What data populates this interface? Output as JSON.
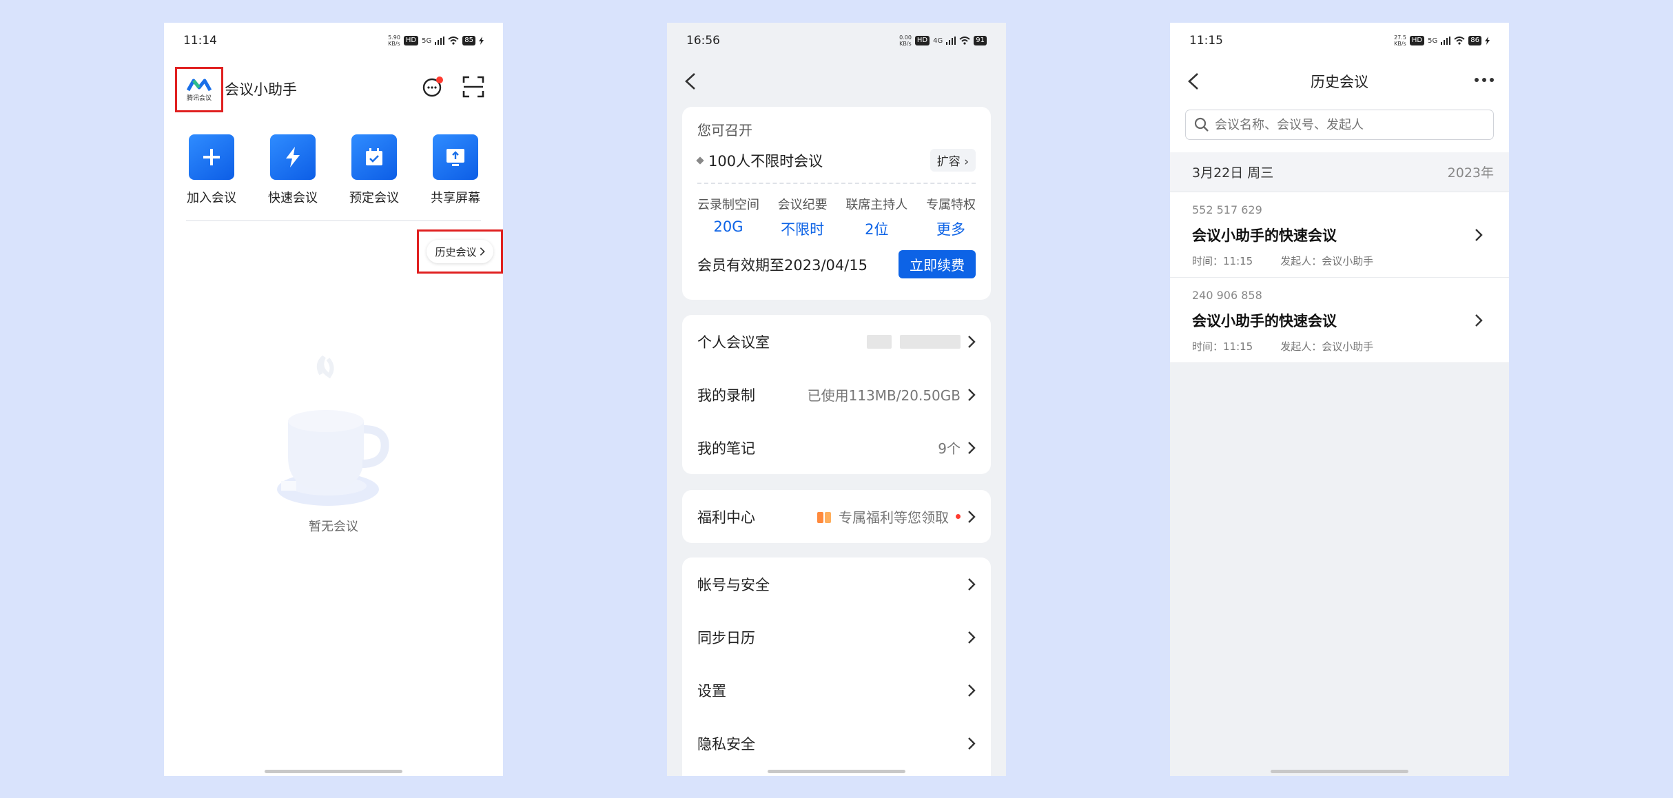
{
  "colors": {
    "accent": "#0d63e6",
    "highlight": "#e02020"
  },
  "phone1": {
    "status": {
      "time": "11:14",
      "speed": "5.90\nKB/s",
      "hd": "HD",
      "net": "5G",
      "battery": "85"
    },
    "logo_text": "腾讯会议",
    "app_title": "会议小助手",
    "icons": {
      "chat": "chat-bubble-icon",
      "scan": "scan-icon"
    },
    "actions": [
      {
        "label": "加入会议",
        "icon": "plus-icon"
      },
      {
        "label": "快速会议",
        "icon": "lightning-icon"
      },
      {
        "label": "预定会议",
        "icon": "calendar-check-icon"
      },
      {
        "label": "共享屏幕",
        "icon": "share-screen-icon"
      }
    ],
    "history_button": "历史会议",
    "empty_text": "暂无会议"
  },
  "phone2": {
    "status": {
      "time": "16:56",
      "speed": "0.00\nKB/s",
      "hd": "HD",
      "net": "4G",
      "battery": "91"
    },
    "member": {
      "can_open": "您可召开",
      "plan": "100人不限时会议",
      "expand": "扩容",
      "stats": [
        {
          "k": "云录制空间",
          "v": "20G"
        },
        {
          "k": "会议纪要",
          "v": "不限时"
        },
        {
          "k": "联席主持人",
          "v": "2位"
        },
        {
          "k": "专属特权",
          "v": "更多"
        }
      ],
      "expire": "会员有效期至2023/04/15",
      "renew": "立即续费"
    },
    "group1": [
      {
        "k": "个人会议室",
        "v": ""
      },
      {
        "k": "我的录制",
        "v": "已使用113MB/20.50GB"
      },
      {
        "k": "我的笔记",
        "v": "9个"
      }
    ],
    "welfare": {
      "k": "福利中心",
      "v": "专属福利等您领取"
    },
    "group3": [
      {
        "k": "帐号与安全"
      },
      {
        "k": "同步日历"
      },
      {
        "k": "设置"
      },
      {
        "k": "隐私安全"
      }
    ]
  },
  "phone3": {
    "status": {
      "time": "11:15",
      "speed": "27.5\nKB/s",
      "hd": "HD",
      "net": "5G",
      "battery": "86"
    },
    "title": "历史会议",
    "search_placeholder": "会议名称、会议号、发起人",
    "date": "3月22日 周三",
    "year": "2023年",
    "meetings": [
      {
        "num": "552 517 629",
        "name": "会议小助手的快速会议",
        "time": "时间：11:15",
        "host": "发起人：会议小助手"
      },
      {
        "num": "240 906 858",
        "name": "会议小助手的快速会议",
        "time": "时间：11:15",
        "host": "发起人：会议小助手"
      }
    ]
  }
}
